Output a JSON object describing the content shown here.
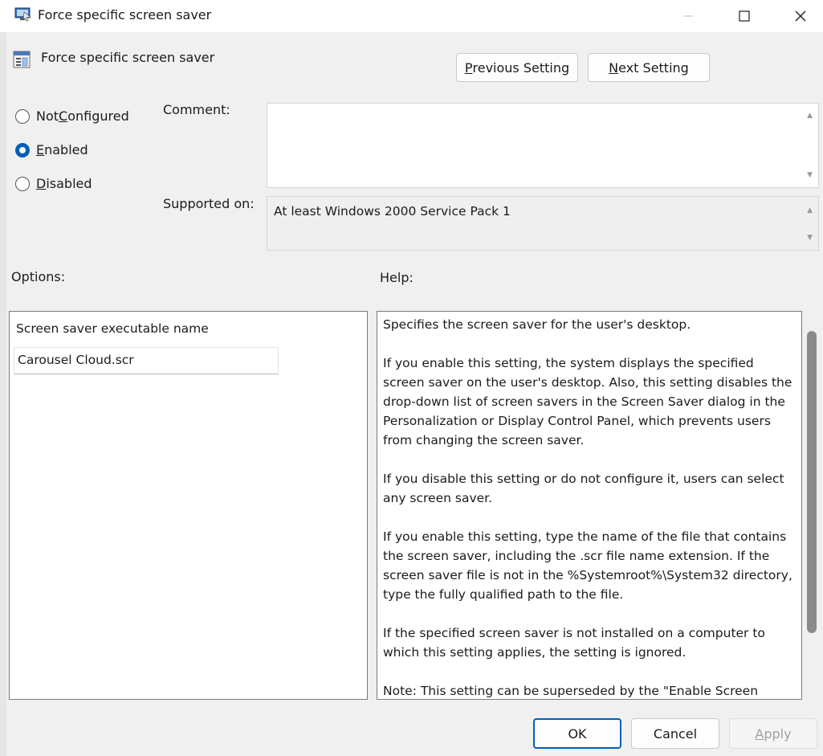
{
  "window": {
    "title": "Force specific screen saver",
    "controls": [
      "minimize-icon",
      "maximize-icon",
      "close-icon"
    ]
  },
  "header": {
    "policy_name": "Force specific screen saver",
    "previous_label_key": "P",
    "previous_label_rest": "revious Setting",
    "next_label_key": "N",
    "next_label_rest": "ext Setting"
  },
  "state": {
    "options": [
      {
        "pre": "Not ",
        "key": "C",
        "post": "onfigured",
        "selected": false
      },
      {
        "pre": "",
        "key": "E",
        "post": "nabled",
        "selected": true
      },
      {
        "pre": "",
        "key": "D",
        "post": "isabled",
        "selected": false
      }
    ]
  },
  "comment": {
    "label": "Comment:",
    "value": ""
  },
  "supported": {
    "label": "Supported on:",
    "value": "At least Windows 2000 Service Pack 1"
  },
  "options_panel": {
    "label": "Options:",
    "field_label": "Screen saver executable name",
    "field_value": "Carousel Cloud.scr"
  },
  "help_panel": {
    "label": "Help:",
    "paragraphs": [
      "Specifies the screen saver for the user's desktop.",
      "If you enable this setting, the system displays the specified screen saver on the user's desktop. Also, this setting disables the drop-down list of screen savers in the Screen Saver dialog in the Personalization or Display Control Panel, which prevents users from changing the screen saver.",
      "If you disable this setting or do not configure it, users can select any screen saver.",
      "If you enable this setting, type the name of the file that contains the screen saver, including the .scr file name extension. If the screen saver file is not in the %Systemroot%\\System32 directory, type the fully qualified path to the file.",
      "If the specified screen saver is not installed on a computer to which this setting applies, the setting is ignored.",
      "Note: This setting can be superseded by the \"Enable Screen Saver\""
    ]
  },
  "footer": {
    "ok_label": "OK",
    "cancel_label": "Cancel",
    "apply_label_key": "A",
    "apply_label_rest": "pply"
  },
  "colors": {
    "accent": "#005fb8",
    "background": "#f0f0f0"
  }
}
